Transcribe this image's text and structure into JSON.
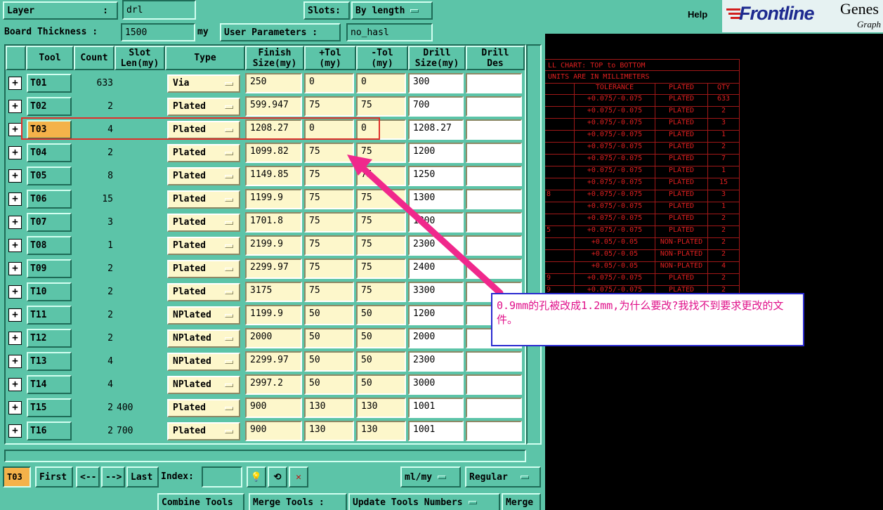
{
  "top_bar": {
    "layer_label": "Layer",
    "layer_sep": ":",
    "layer_value": "drl",
    "slots_label": "Slots:",
    "slots_value": "By length",
    "board_thickness_label": "Board Thickness :",
    "board_thickness_value": "1500",
    "board_thickness_unit": "my",
    "user_params_label": "User Parameters :",
    "user_params_value": "no_hasl"
  },
  "table": {
    "headers": [
      "Tool",
      "Count",
      "Slot\nLen(my)",
      "Type",
      "Finish\nSize(my)",
      "+Tol\n(my)",
      "-Tol\n(my)",
      "Drill\nSize(my)",
      "Drill\nDes"
    ],
    "rows": [
      {
        "tool": "T01",
        "count": "633",
        "slot": "",
        "type": "Via",
        "finish": "250",
        "ptol": "0",
        "ntol": "0",
        "drill": "300",
        "des": ""
      },
      {
        "tool": "T02",
        "count": "2",
        "slot": "",
        "type": "Plated",
        "finish": "599.947",
        "ptol": "75",
        "ntol": "75",
        "drill": "700",
        "des": ""
      },
      {
        "tool": "T03",
        "count": "4",
        "slot": "",
        "type": "Plated",
        "finish": "1208.27",
        "ptol": "0",
        "ntol": "0",
        "drill": "1208.27",
        "des": ""
      },
      {
        "tool": "T04",
        "count": "2",
        "slot": "",
        "type": "Plated",
        "finish": "1099.82",
        "ptol": "75",
        "ntol": "75",
        "drill": "1200",
        "des": ""
      },
      {
        "tool": "T05",
        "count": "8",
        "slot": "",
        "type": "Plated",
        "finish": "1149.85",
        "ptol": "75",
        "ntol": "75",
        "drill": "1250",
        "des": ""
      },
      {
        "tool": "T06",
        "count": "15",
        "slot": "",
        "type": "Plated",
        "finish": "1199.9",
        "ptol": "75",
        "ntol": "75",
        "drill": "1300",
        "des": ""
      },
      {
        "tool": "T07",
        "count": "3",
        "slot": "",
        "type": "Plated",
        "finish": "1701.8",
        "ptol": "75",
        "ntol": "75",
        "drill": "1800",
        "des": ""
      },
      {
        "tool": "T08",
        "count": "1",
        "slot": "",
        "type": "Plated",
        "finish": "2199.9",
        "ptol": "75",
        "ntol": "75",
        "drill": "2300",
        "des": ""
      },
      {
        "tool": "T09",
        "count": "2",
        "slot": "",
        "type": "Plated",
        "finish": "2299.97",
        "ptol": "75",
        "ntol": "75",
        "drill": "2400",
        "des": ""
      },
      {
        "tool": "T10",
        "count": "2",
        "slot": "",
        "type": "Plated",
        "finish": "3175",
        "ptol": "75",
        "ntol": "75",
        "drill": "3300",
        "des": ""
      },
      {
        "tool": "T11",
        "count": "2",
        "slot": "",
        "type": "NPlated",
        "finish": "1199.9",
        "ptol": "50",
        "ntol": "50",
        "drill": "1200",
        "des": ""
      },
      {
        "tool": "T12",
        "count": "2",
        "slot": "",
        "type": "NPlated",
        "finish": "2000",
        "ptol": "50",
        "ntol": "50",
        "drill": "2000",
        "des": ""
      },
      {
        "tool": "T13",
        "count": "4",
        "slot": "",
        "type": "NPlated",
        "finish": "2299.97",
        "ptol": "50",
        "ntol": "50",
        "drill": "2300",
        "des": ""
      },
      {
        "tool": "T14",
        "count": "4",
        "slot": "",
        "type": "NPlated",
        "finish": "2997.2",
        "ptol": "50",
        "ntol": "50",
        "drill": "3000",
        "des": ""
      },
      {
        "tool": "T15",
        "count": "2",
        "slot": "400",
        "type": "Plated",
        "finish": "900",
        "ptol": "130",
        "ntol": "130",
        "drill": "1001",
        "des": ""
      },
      {
        "tool": "T16",
        "count": "2",
        "slot": "700",
        "type": "Plated",
        "finish": "900",
        "ptol": "130",
        "ntol": "130",
        "drill": "1001",
        "des": ""
      }
    ]
  },
  "bottom_bar": {
    "current_tool": "T03",
    "first": "First",
    "prev": "<--",
    "next": "-->",
    "last": "Last",
    "index_label": "Index:",
    "units": "ml/my",
    "mode": "Regular"
  },
  "footer_buttons": {
    "combine": "Combine Tools",
    "merge_tools": "Merge Tools :",
    "update": "Update Tools Numbers",
    "merge": "Merge"
  },
  "right_header": {
    "help": "Help",
    "logo": "Frontline",
    "logo_product": "Genes",
    "logo_sub": "Graph"
  },
  "drill_chart": {
    "title": "LL CHART: TOP to BOTTOM",
    "units": "UNITS ARE IN MILLIMETERS",
    "headers": [
      "TOLERANCE",
      "PLATED",
      "QTY"
    ],
    "rows": [
      {
        "left": "",
        "tol": "+0.075/-0.075",
        "plated": "PLATED",
        "qty": "633"
      },
      {
        "left": "",
        "tol": "+0.075/-0.075",
        "plated": "PLATED",
        "qty": "2"
      },
      {
        "left": "",
        "tol": "+0.075/-0.075",
        "plated": "PLATED",
        "qty": "3"
      },
      {
        "left": "",
        "tol": "+0.075/-0.075",
        "plated": "PLATED",
        "qty": "1"
      },
      {
        "left": "",
        "tol": "+0.075/-0.075",
        "plated": "PLATED",
        "qty": "2"
      },
      {
        "left": "",
        "tol": "+0.075/-0.075",
        "plated": "PLATED",
        "qty": "7"
      },
      {
        "left": "",
        "tol": "+0.075/-0.075",
        "plated": "PLATED",
        "qty": "1"
      },
      {
        "left": "",
        "tol": "+0.075/-0.075",
        "plated": "PLATED",
        "qty": "15"
      },
      {
        "left": "8",
        "tol": "+0.075/-0.075",
        "plated": "PLATED",
        "qty": "3"
      },
      {
        "left": "",
        "tol": "+0.075/-0.075",
        "plated": "PLATED",
        "qty": "1"
      },
      {
        "left": "",
        "tol": "+0.075/-0.075",
        "plated": "PLATED",
        "qty": "2"
      },
      {
        "left": "5",
        "tol": "+0.075/-0.075",
        "plated": "PLATED",
        "qty": "2"
      },
      {
        "left": "",
        "tol": "+0.05/-0.05",
        "plated": "NON-PLATED",
        "qty": "2"
      },
      {
        "left": "",
        "tol": "+0.05/-0.05",
        "plated": "NON-PLATED",
        "qty": "2"
      },
      {
        "left": "",
        "tol": "+0.05/-0.05",
        "plated": "NON-PLATED",
        "qty": "4"
      },
      {
        "left": "9",
        "tol": "+0.075/-0.075",
        "plated": "PLATED",
        "qty": "2"
      },
      {
        "left": "9",
        "tol": "+0.075/-0.075",
        "plated": "PLATED",
        "qty": "2"
      }
    ]
  },
  "annotation": {
    "note": "0.9mm的孔被改成1.2mm,为什么要改?我找不到要求更改的文件。"
  },
  "colors": {
    "panel": "#5cc4a8",
    "input": "#fdf7cb",
    "selected_tool": "#f4b24a",
    "chart_red": "#e02020",
    "arrow": "#f0288c"
  }
}
